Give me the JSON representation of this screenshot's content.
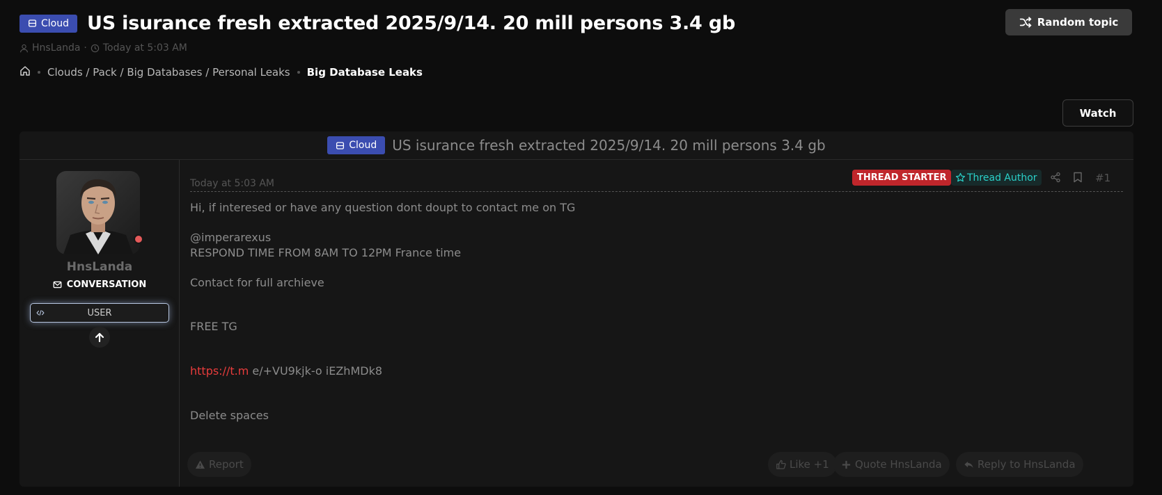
{
  "header": {
    "prefix": "Cloud",
    "title": "US isurance fresh extracted 2025/9/14. 20 mill persons 3.4 gb",
    "author": "HnsLanda",
    "meta_separator": "·",
    "time": "Today at 5:03 AM",
    "random_label": "Random topic"
  },
  "breadcrumb": {
    "path": "Clouds / Pack / Big Databases / Personal Leaks",
    "current": "Big Database Leaks"
  },
  "watch_label": "Watch",
  "thread": {
    "prefix": "Cloud",
    "title": "US isurance fresh extracted 2025/9/14. 20 mill persons 3.4 gb"
  },
  "user": {
    "name": "HnsLanda",
    "conversation_label": "CONVERSATION",
    "role": "USER"
  },
  "post": {
    "time": "Today at 5:03 AM",
    "badge_starter": "THREAD STARTER",
    "badge_author": "Thread Author",
    "number": "#1",
    "lines": [
      "Hi, if interesed or have any question dont doupt to contact me on TG",
      "@imperarexus",
      "RESPOND TIME FROM 8AM TO 12PM France time",
      "Contact for full archieve",
      "FREE TG"
    ],
    "link_text": "https://t.m",
    "link_rest": " e/+VU9kjk-o iEZhMDk8",
    "final_line": "Delete spaces"
  },
  "actions": {
    "report": "Report",
    "like": "Like +1",
    "quote": "Quote HnsLanda",
    "reply": "Reply to HnsLanda"
  },
  "colors": {
    "accent_prefix": "#3b4db0",
    "starter_red": "#c0262b",
    "author_teal": "#2ad1c9",
    "link_red": "#e83c3c",
    "online_dot": "#e55a5a"
  },
  "icons": [
    "database-icon",
    "user-icon",
    "clock-icon",
    "home-icon",
    "shuffle-icon",
    "envelope-icon",
    "code-icon",
    "arrow-up-icon",
    "star-icon",
    "share-icon",
    "bookmark-icon",
    "warning-icon",
    "thumbs-up-icon",
    "plus-icon",
    "reply-icon"
  ]
}
